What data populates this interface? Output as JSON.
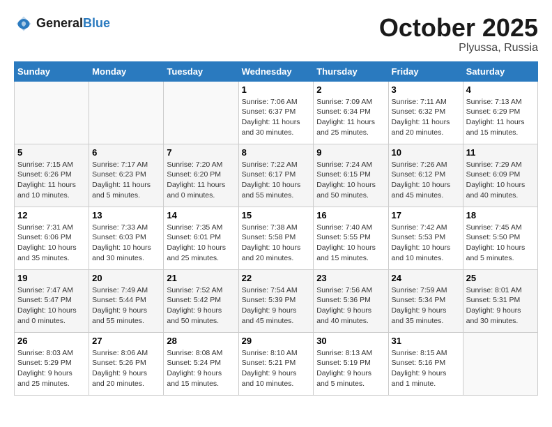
{
  "header": {
    "logo_general": "General",
    "logo_blue": "Blue",
    "month": "October 2025",
    "location": "Plyussa, Russia"
  },
  "weekdays": [
    "Sunday",
    "Monday",
    "Tuesday",
    "Wednesday",
    "Thursday",
    "Friday",
    "Saturday"
  ],
  "weeks": [
    [
      {
        "day": "",
        "info": ""
      },
      {
        "day": "",
        "info": ""
      },
      {
        "day": "",
        "info": ""
      },
      {
        "day": "1",
        "info": "Sunrise: 7:06 AM\nSunset: 6:37 PM\nDaylight: 11 hours\nand 30 minutes."
      },
      {
        "day": "2",
        "info": "Sunrise: 7:09 AM\nSunset: 6:34 PM\nDaylight: 11 hours\nand 25 minutes."
      },
      {
        "day": "3",
        "info": "Sunrise: 7:11 AM\nSunset: 6:32 PM\nDaylight: 11 hours\nand 20 minutes."
      },
      {
        "day": "4",
        "info": "Sunrise: 7:13 AM\nSunset: 6:29 PM\nDaylight: 11 hours\nand 15 minutes."
      }
    ],
    [
      {
        "day": "5",
        "info": "Sunrise: 7:15 AM\nSunset: 6:26 PM\nDaylight: 11 hours\nand 10 minutes."
      },
      {
        "day": "6",
        "info": "Sunrise: 7:17 AM\nSunset: 6:23 PM\nDaylight: 11 hours\nand 5 minutes."
      },
      {
        "day": "7",
        "info": "Sunrise: 7:20 AM\nSunset: 6:20 PM\nDaylight: 11 hours\nand 0 minutes."
      },
      {
        "day": "8",
        "info": "Sunrise: 7:22 AM\nSunset: 6:17 PM\nDaylight: 10 hours\nand 55 minutes."
      },
      {
        "day": "9",
        "info": "Sunrise: 7:24 AM\nSunset: 6:15 PM\nDaylight: 10 hours\nand 50 minutes."
      },
      {
        "day": "10",
        "info": "Sunrise: 7:26 AM\nSunset: 6:12 PM\nDaylight: 10 hours\nand 45 minutes."
      },
      {
        "day": "11",
        "info": "Sunrise: 7:29 AM\nSunset: 6:09 PM\nDaylight: 10 hours\nand 40 minutes."
      }
    ],
    [
      {
        "day": "12",
        "info": "Sunrise: 7:31 AM\nSunset: 6:06 PM\nDaylight: 10 hours\nand 35 minutes."
      },
      {
        "day": "13",
        "info": "Sunrise: 7:33 AM\nSunset: 6:03 PM\nDaylight: 10 hours\nand 30 minutes."
      },
      {
        "day": "14",
        "info": "Sunrise: 7:35 AM\nSunset: 6:01 PM\nDaylight: 10 hours\nand 25 minutes."
      },
      {
        "day": "15",
        "info": "Sunrise: 7:38 AM\nSunset: 5:58 PM\nDaylight: 10 hours\nand 20 minutes."
      },
      {
        "day": "16",
        "info": "Sunrise: 7:40 AM\nSunset: 5:55 PM\nDaylight: 10 hours\nand 15 minutes."
      },
      {
        "day": "17",
        "info": "Sunrise: 7:42 AM\nSunset: 5:53 PM\nDaylight: 10 hours\nand 10 minutes."
      },
      {
        "day": "18",
        "info": "Sunrise: 7:45 AM\nSunset: 5:50 PM\nDaylight: 10 hours\nand 5 minutes."
      }
    ],
    [
      {
        "day": "19",
        "info": "Sunrise: 7:47 AM\nSunset: 5:47 PM\nDaylight: 10 hours\nand 0 minutes."
      },
      {
        "day": "20",
        "info": "Sunrise: 7:49 AM\nSunset: 5:44 PM\nDaylight: 9 hours\nand 55 minutes."
      },
      {
        "day": "21",
        "info": "Sunrise: 7:52 AM\nSunset: 5:42 PM\nDaylight: 9 hours\nand 50 minutes."
      },
      {
        "day": "22",
        "info": "Sunrise: 7:54 AM\nSunset: 5:39 PM\nDaylight: 9 hours\nand 45 minutes."
      },
      {
        "day": "23",
        "info": "Sunrise: 7:56 AM\nSunset: 5:36 PM\nDaylight: 9 hours\nand 40 minutes."
      },
      {
        "day": "24",
        "info": "Sunrise: 7:59 AM\nSunset: 5:34 PM\nDaylight: 9 hours\nand 35 minutes."
      },
      {
        "day": "25",
        "info": "Sunrise: 8:01 AM\nSunset: 5:31 PM\nDaylight: 9 hours\nand 30 minutes."
      }
    ],
    [
      {
        "day": "26",
        "info": "Sunrise: 8:03 AM\nSunset: 5:29 PM\nDaylight: 9 hours\nand 25 minutes."
      },
      {
        "day": "27",
        "info": "Sunrise: 8:06 AM\nSunset: 5:26 PM\nDaylight: 9 hours\nand 20 minutes."
      },
      {
        "day": "28",
        "info": "Sunrise: 8:08 AM\nSunset: 5:24 PM\nDaylight: 9 hours\nand 15 minutes."
      },
      {
        "day": "29",
        "info": "Sunrise: 8:10 AM\nSunset: 5:21 PM\nDaylight: 9 hours\nand 10 minutes."
      },
      {
        "day": "30",
        "info": "Sunrise: 8:13 AM\nSunset: 5:19 PM\nDaylight: 9 hours\nand 5 minutes."
      },
      {
        "day": "31",
        "info": "Sunrise: 8:15 AM\nSunset: 5:16 PM\nDaylight: 9 hours\nand 1 minute."
      },
      {
        "day": "",
        "info": ""
      }
    ]
  ]
}
